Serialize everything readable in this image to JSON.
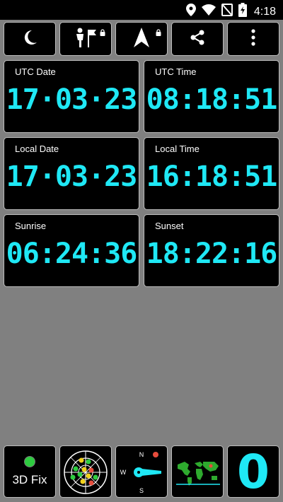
{
  "status": {
    "time": "4:18"
  },
  "tiles": [
    {
      "label": "UTC Date",
      "value": "17·03·23"
    },
    {
      "label": "UTC Time",
      "value": "08:18:51"
    },
    {
      "label": "Local Date",
      "value": "17·03·23"
    },
    {
      "label": "Local Time",
      "value": "16:18:51"
    },
    {
      "label": "Sunrise",
      "value": "06:24:36"
    },
    {
      "label": "Sunset",
      "value": "18:22:16"
    }
  ],
  "bottom": {
    "fix_label": "3D Fix",
    "satellite_count": "0",
    "compass": {
      "north": "N",
      "west": "W",
      "south": "S"
    }
  },
  "colors": {
    "accent": "#1fe8f5",
    "tile_bg": "#000000",
    "page_bg": "#808080",
    "fix": "#2ecc40"
  },
  "icons": [
    "location-icon",
    "wifi-icon",
    "no-sim-icon",
    "battery-charging-icon",
    "moon-icon",
    "waypoint-person-flag-icon",
    "lock-icon",
    "navigation-arrow-icon",
    "share-icon",
    "more-vert-icon",
    "satellite-radar-icon",
    "compass-icon",
    "world-map-icon"
  ]
}
